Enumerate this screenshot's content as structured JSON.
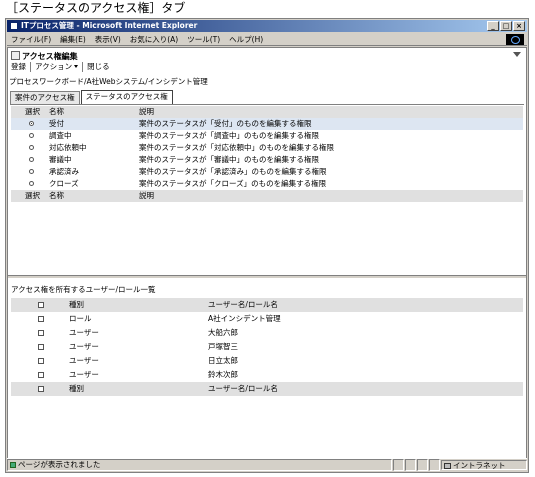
{
  "caption": "［ステータスのアクセス権］タブ",
  "window": {
    "title": "ITプロセス管理 - Microsoft Internet Explorer",
    "menu": [
      "ファイル(F)",
      "編集(E)",
      "表示(V)",
      "お気に入り(A)",
      "ツール(T)",
      "ヘルプ(H)"
    ]
  },
  "section": {
    "title": "アクセス権編集",
    "toolbar": {
      "register": "登録",
      "action": "アクション",
      "close": "閉じる"
    },
    "breadcrumb": "プロセスワークボード/A社Webシステム/インシデント管理"
  },
  "tabs": [
    "案件のアクセス権",
    "ステータスのアクセス権"
  ],
  "status_table": {
    "headers": {
      "select": "選択",
      "name": "名称",
      "desc": "説明"
    },
    "rows": [
      {
        "name": "受付",
        "desc": "案件のステータスが「受付」のものを編集する権限",
        "selected": true
      },
      {
        "name": "調査中",
        "desc": "案件のステータスが「調査中」のものを編集する権限",
        "selected": false
      },
      {
        "name": "対応依頼中",
        "desc": "案件のステータスが「対応依頼中」のものを編集する権限",
        "selected": false
      },
      {
        "name": "審議中",
        "desc": "案件のステータスが「審議中」のものを編集する権限",
        "selected": false
      },
      {
        "name": "承認済み",
        "desc": "案件のステータスが「承認済み」のものを編集する権限",
        "selected": false
      },
      {
        "name": "クローズ",
        "desc": "案件のステータスが「クローズ」のものを編集する権限",
        "selected": false
      }
    ]
  },
  "user_section": {
    "title": "アクセス権を所有するユーザー/ロール一覧",
    "headers": {
      "type": "種別",
      "name": "ユーザー名/ロール名"
    },
    "rows": [
      {
        "type": "ロール",
        "name": "A社インシデント管理"
      },
      {
        "type": "ユーザー",
        "name": "大船六郎"
      },
      {
        "type": "ユーザー",
        "name": "戸塚智三"
      },
      {
        "type": "ユーザー",
        "name": "日立太郎"
      },
      {
        "type": "ユーザー",
        "name": "鈴木次郎"
      }
    ]
  },
  "statusbar": {
    "message": "ページが表示されました",
    "zone": "イントラネット"
  }
}
